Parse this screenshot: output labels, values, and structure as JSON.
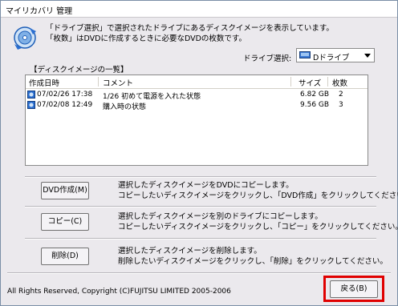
{
  "window": {
    "title": "マイリカバリ 管理"
  },
  "description": {
    "line1": "「ドライブ選択」で選択されたドライブにあるディスクイメージを表示しています。",
    "line2": "「枚数」はDVDに作成するときに必要なDVDの枚数です。"
  },
  "drive": {
    "label": "ドライブ選択:",
    "selected": "Dドライブ"
  },
  "list": {
    "title": "【ディスクイメージの一覧】",
    "columns": [
      "作成日時",
      "コメント",
      "サイズ",
      "枚数"
    ],
    "rows": [
      {
        "date": "07/02/26 17:38",
        "comment": "1/26 初めて電源を入れた状態",
        "size": "6.82 GB",
        "count": "2"
      },
      {
        "date": "07/02/08 12:49",
        "comment": "購入時の状態",
        "size": "9.56 GB",
        "count": "3"
      }
    ]
  },
  "actions": {
    "dvd": {
      "label": "DVD作成(M)",
      "desc1": "選択したディスクイメージをDVDにコピーします。",
      "desc2": "コピーしたいディスクイメージをクリックし、「DVD作成」をクリックしてください。"
    },
    "copy": {
      "label": "コピー(C)",
      "desc1": "選択したディスクイメージを別のドライブにコピーします。",
      "desc2": "コピーしたいディスクイメージをクリックし、「コピー」をクリックしてください。"
    },
    "delete": {
      "label": "削除(D)",
      "desc1": "選択したディスクイメージを削除します。",
      "desc2": "削除したいディスクイメージをクリックし、「削除」をクリックしてください。"
    }
  },
  "footer": {
    "copyright": "All Rights Reserved, Copyright (C)FUJITSU LIMITED 2005-2006",
    "back_label": "戻る(B)"
  },
  "colors": {
    "highlight": "#e00000",
    "icon_blue": "#1f5fb8"
  }
}
